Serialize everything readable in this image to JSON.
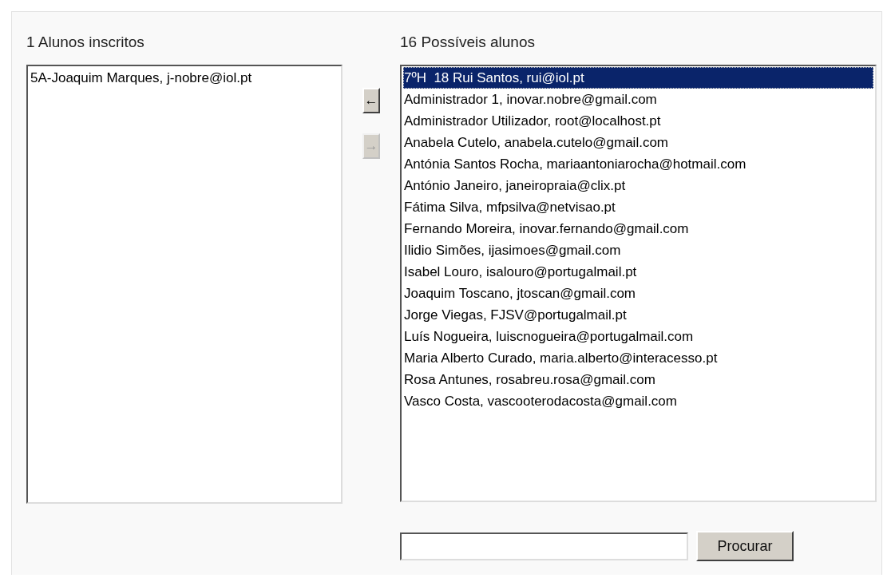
{
  "enrolled": {
    "heading": "1 Alunos inscritos",
    "items": [
      {
        "label": "5A-Joaquim Marques, j-nobre@iol.pt",
        "selected": false
      }
    ]
  },
  "move_buttons": [
    {
      "label": "←",
      "disabled": false
    },
    {
      "label": "→",
      "disabled": true
    }
  ],
  "candidates": {
    "heading": "16 Possíveis alunos",
    "items": [
      {
        "label": "7ºH  18 Rui Santos, rui@iol.pt",
        "selected": true
      },
      {
        "label": "Administrador 1, inovar.nobre@gmail.com",
        "selected": false
      },
      {
        "label": "Administrador Utilizador, root@localhost.pt",
        "selected": false
      },
      {
        "label": "Anabela Cutelo, anabela.cutelo@gmail.com",
        "selected": false
      },
      {
        "label": "Antónia Santos Rocha, mariaantoniarocha@hotmail.com",
        "selected": false
      },
      {
        "label": "António Janeiro, janeiropraia@clix.pt",
        "selected": false
      },
      {
        "label": "Fátima Silva, mfpsilva@netvisao.pt",
        "selected": false
      },
      {
        "label": "Fernando Moreira, inovar.fernando@gmail.com",
        "selected": false
      },
      {
        "label": "Ilidio Simões, ijasimoes@gmail.com",
        "selected": false
      },
      {
        "label": "Isabel Louro, isalouro@portugalmail.pt",
        "selected": false
      },
      {
        "label": "Joaquim Toscano, jtoscan@gmail.com",
        "selected": false
      },
      {
        "label": "Jorge Viegas, FJSV@portugalmail.pt",
        "selected": false
      },
      {
        "label": "Luís Nogueira, luiscnogueira@portugalmail.com",
        "selected": false
      },
      {
        "label": "Maria Alberto Curado, maria.alberto@interacesso.pt",
        "selected": false
      },
      {
        "label": "Rosa Antunes, rosabreu.rosa@gmail.com",
        "selected": false
      },
      {
        "label": "Vasco Costa, vascooterodacosta@gmail.com",
        "selected": false
      }
    ]
  },
  "search": {
    "button": "Procurar"
  }
}
